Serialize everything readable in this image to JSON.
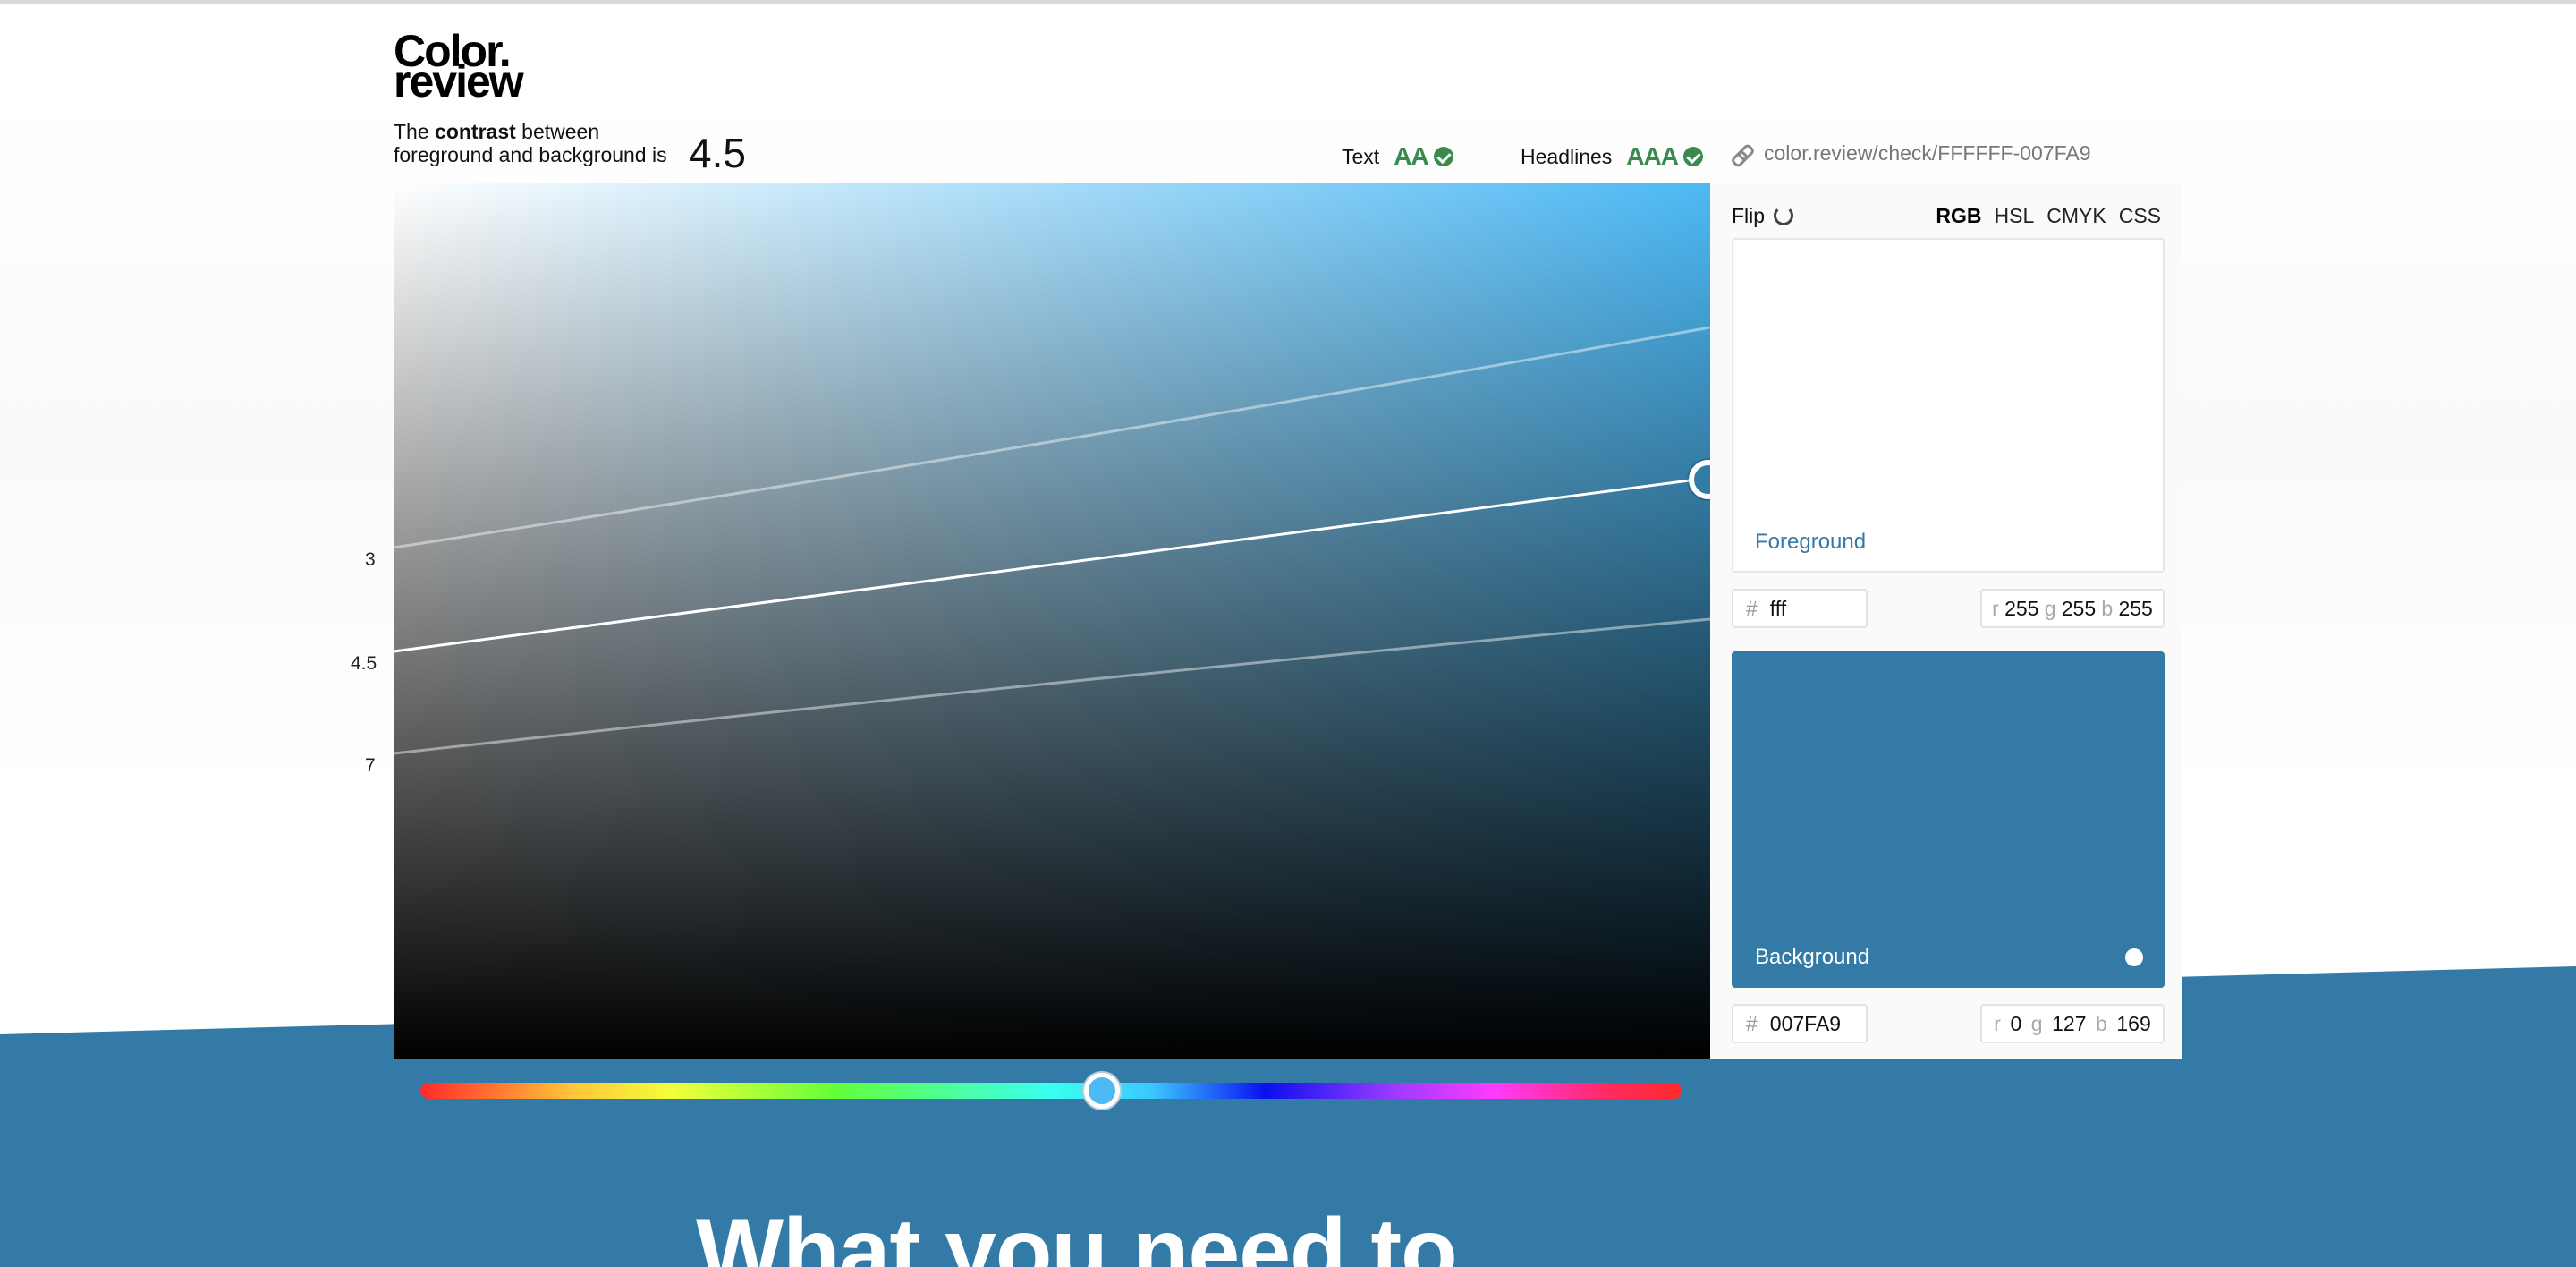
{
  "logo": {
    "line1": "Color.",
    "line2": "review"
  },
  "contrast": {
    "prefix": "The ",
    "bold": "contrast",
    "middle": " between",
    "line2": "foreground and background is",
    "value": "4.5"
  },
  "wcag": {
    "text_label": "Text",
    "text_grade": "AA",
    "headlines_label": "Headlines",
    "headlines_grade": "AAA",
    "pass_color": "#3a8a4e"
  },
  "share": {
    "url": "color.review/check/FFFFFF-007FA9",
    "icon": "link-icon"
  },
  "picker": {
    "ratio_labels": [
      "3",
      "4.5",
      "7"
    ],
    "gradient_end_color": "#4db9f5"
  },
  "side": {
    "flip_label": "Flip",
    "flip_icon": "rotate-icon",
    "modes": [
      "RGB",
      "HSL",
      "CMYK",
      "CSS"
    ],
    "active_mode": "RGB"
  },
  "foreground": {
    "label": "Foreground",
    "hex": "fff",
    "r": "255",
    "g": "255",
    "b": "255",
    "color": "#ffffff"
  },
  "background": {
    "label": "Background",
    "hex": "007FA9",
    "r": "0",
    "g": "127",
    "b": "169",
    "color": "#337BA6"
  },
  "hero": {
    "heading": "What you need to"
  },
  "channels": {
    "r": "r",
    "g": "g",
    "b": "b",
    "hash": "#"
  }
}
